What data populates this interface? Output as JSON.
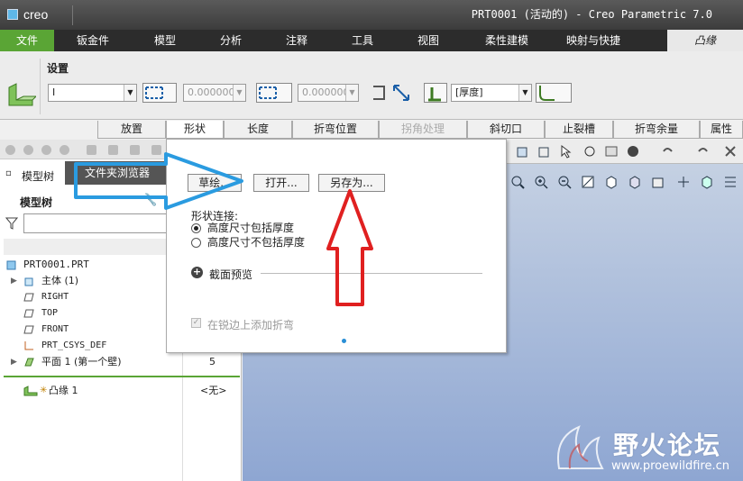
{
  "window": {
    "app_logo": "creo",
    "title": "PRT0001 (活动的) - Creo Parametric 7.0"
  },
  "ribbon": {
    "tabs": [
      "文件",
      "钣金件",
      "模型",
      "分析",
      "注释",
      "工具",
      "视图",
      "柔性建模",
      "映射与快捷"
    ],
    "active_tab": "凸缘"
  },
  "settings": {
    "label": "设置",
    "shape_value": "I",
    "length1": "0.000000",
    "length2": "0.000000",
    "thickness_value": "[厚度]"
  },
  "subtabs": [
    "放置",
    "形状",
    "长度",
    "折弯位置",
    "拐角处理",
    "斜切口",
    "止裂槽",
    "折弯余量",
    "属性"
  ],
  "left_panel": {
    "tab_model_tree": "模型树",
    "tab_file_browser": "文件夹浏览器",
    "tree_title": "模型树",
    "items": [
      {
        "label": "PRT0001.PRT",
        "value": ""
      },
      {
        "label": "主体 (1)",
        "value": ""
      },
      {
        "label": "RIGHT",
        "value": ""
      },
      {
        "label": "TOP",
        "value": ""
      },
      {
        "label": "FRONT",
        "value": ""
      },
      {
        "label": "PRT_CSYS_DEF",
        "value": ""
      },
      {
        "label": "平面 1 (第一个壁)",
        "value": "5"
      }
    ],
    "insert_item": {
      "label": "凸缘 1",
      "value": "<无>"
    }
  },
  "popup": {
    "btn_sketch": "草绘...",
    "btn_open": "打开...",
    "btn_save_as": "另存为...",
    "shape_connection_label": "形状连接:",
    "radio1": "高度尺寸包括厚度",
    "radio2": "高度尺寸不包括厚度",
    "section_preview": "截面预览",
    "checkbox_label": "在锐边上添加折弯"
  },
  "annotations": {
    "blue_arrow_color": "#2a9be0",
    "red_arrow_color": "#e02020"
  },
  "watermark": {
    "title": "野火论坛",
    "url": "www.proewildfire.cn"
  }
}
